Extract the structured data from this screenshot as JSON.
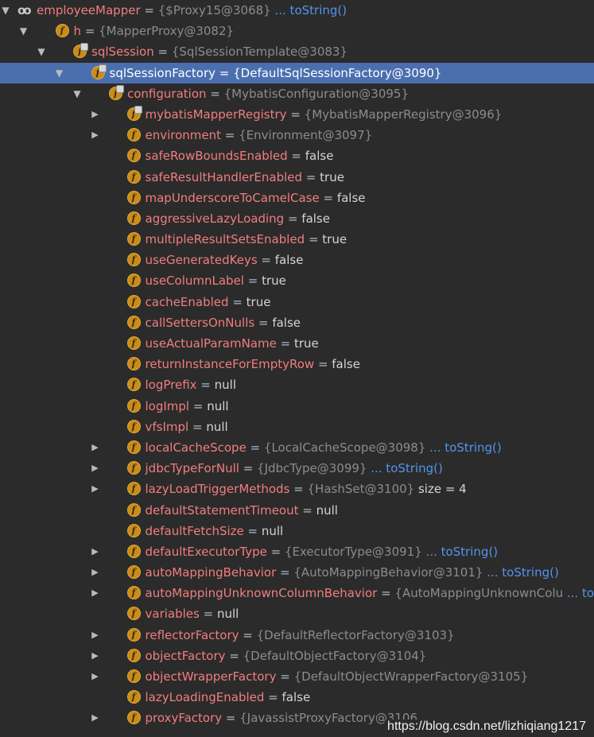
{
  "rows": [
    {
      "level": 0,
      "arrow": "down",
      "icon": "watch",
      "name": "employeeMapper",
      "type": "{$Proxy15@3068}",
      "tostring": "... toString()"
    },
    {
      "level": 1,
      "arrow": "down",
      "icon": "field",
      "name": "h",
      "type": "{MapperProxy@3082}"
    },
    {
      "level": 2,
      "arrow": "down",
      "icon": "field-final",
      "name": "sqlSession",
      "type": "{SqlSessionTemplate@3083}"
    },
    {
      "level": 3,
      "arrow": "down",
      "icon": "field-final",
      "name": "sqlSessionFactory",
      "type": "{DefaultSqlSessionFactory@3090}",
      "selected": true
    },
    {
      "level": 4,
      "arrow": "down",
      "icon": "field-final",
      "name": "configuration",
      "type": "{MybatisConfiguration@3095}"
    },
    {
      "level": 5,
      "arrow": "right",
      "icon": "field-final",
      "name": "mybatisMapperRegistry",
      "type": "{MybatisMapperRegistry@3096}"
    },
    {
      "level": 5,
      "arrow": "right",
      "icon": "field",
      "name": "environment",
      "type": "{Environment@3097}"
    },
    {
      "level": 5,
      "icon": "field",
      "name": "safeRowBoundsEnabled",
      "value": "false"
    },
    {
      "level": 5,
      "icon": "field",
      "name": "safeResultHandlerEnabled",
      "value": "true"
    },
    {
      "level": 5,
      "icon": "field",
      "name": "mapUnderscoreToCamelCase",
      "value": "false"
    },
    {
      "level": 5,
      "icon": "field",
      "name": "aggressiveLazyLoading",
      "value": "false"
    },
    {
      "level": 5,
      "icon": "field",
      "name": "multipleResultSetsEnabled",
      "value": "true"
    },
    {
      "level": 5,
      "icon": "field",
      "name": "useGeneratedKeys",
      "value": "false"
    },
    {
      "level": 5,
      "icon": "field",
      "name": "useColumnLabel",
      "value": "true"
    },
    {
      "level": 5,
      "icon": "field",
      "name": "cacheEnabled",
      "value": "true"
    },
    {
      "level": 5,
      "icon": "field",
      "name": "callSettersOnNulls",
      "value": "false"
    },
    {
      "level": 5,
      "icon": "field",
      "name": "useActualParamName",
      "value": "true"
    },
    {
      "level": 5,
      "icon": "field",
      "name": "returnInstanceForEmptyRow",
      "value": "false"
    },
    {
      "level": 5,
      "icon": "field",
      "name": "logPrefix",
      "value": "null"
    },
    {
      "level": 5,
      "icon": "field",
      "name": "logImpl",
      "value": "null"
    },
    {
      "level": 5,
      "icon": "field",
      "name": "vfsImpl",
      "value": "null"
    },
    {
      "level": 5,
      "arrow": "right",
      "icon": "field",
      "name": "localCacheScope",
      "type": "{LocalCacheScope@3098}",
      "tostring": "... toString()"
    },
    {
      "level": 5,
      "arrow": "right",
      "icon": "field",
      "name": "jdbcTypeForNull",
      "type": "{JdbcType@3099}",
      "tostring": "... toString()"
    },
    {
      "level": 5,
      "arrow": "right",
      "icon": "field",
      "name": "lazyLoadTriggerMethods",
      "type": "{HashSet@3100}",
      "extra": "size = 4"
    },
    {
      "level": 5,
      "icon": "field",
      "name": "defaultStatementTimeout",
      "value": "null"
    },
    {
      "level": 5,
      "icon": "field",
      "name": "defaultFetchSize",
      "value": "null"
    },
    {
      "level": 5,
      "arrow": "right",
      "icon": "field",
      "name": "defaultExecutorType",
      "type": "{ExecutorType@3091}",
      "tostring": "... toString()"
    },
    {
      "level": 5,
      "arrow": "right",
      "icon": "field",
      "name": "autoMappingBehavior",
      "type": "{AutoMappingBehavior@3101}",
      "tostring": "... toString()"
    },
    {
      "level": 5,
      "arrow": "right",
      "icon": "field",
      "name": "autoMappingUnknownColumnBehavior",
      "type": "{AutoMappingUnknownColu",
      "tostring": "... toString()"
    },
    {
      "level": 5,
      "icon": "field",
      "name": "variables",
      "value": "null"
    },
    {
      "level": 5,
      "arrow": "right",
      "icon": "field",
      "name": "reflectorFactory",
      "type": "{DefaultReflectorFactory@3103}"
    },
    {
      "level": 5,
      "arrow": "right",
      "icon": "field",
      "name": "objectFactory",
      "type": "{DefaultObjectFactory@3104}"
    },
    {
      "level": 5,
      "arrow": "right",
      "icon": "field",
      "name": "objectWrapperFactory",
      "type": "{DefaultObjectWrapperFactory@3105}"
    },
    {
      "level": 5,
      "icon": "field",
      "name": "lazyLoadingEnabled",
      "value": "false"
    },
    {
      "level": 5,
      "arrow": "right",
      "icon": "field",
      "name": "proxyFactory",
      "type": "{JavassistProxyFactory@3106"
    }
  ],
  "watermark": "https://blog.csdn.net/lizhiqiang1217",
  "colors": {
    "background": "#2b2b2b",
    "selection": "#4b6eaf",
    "field_name": "#f17d7f",
    "type_text": "#8c8c8c",
    "link": "#5394ec",
    "icon": "#c98c1a"
  }
}
